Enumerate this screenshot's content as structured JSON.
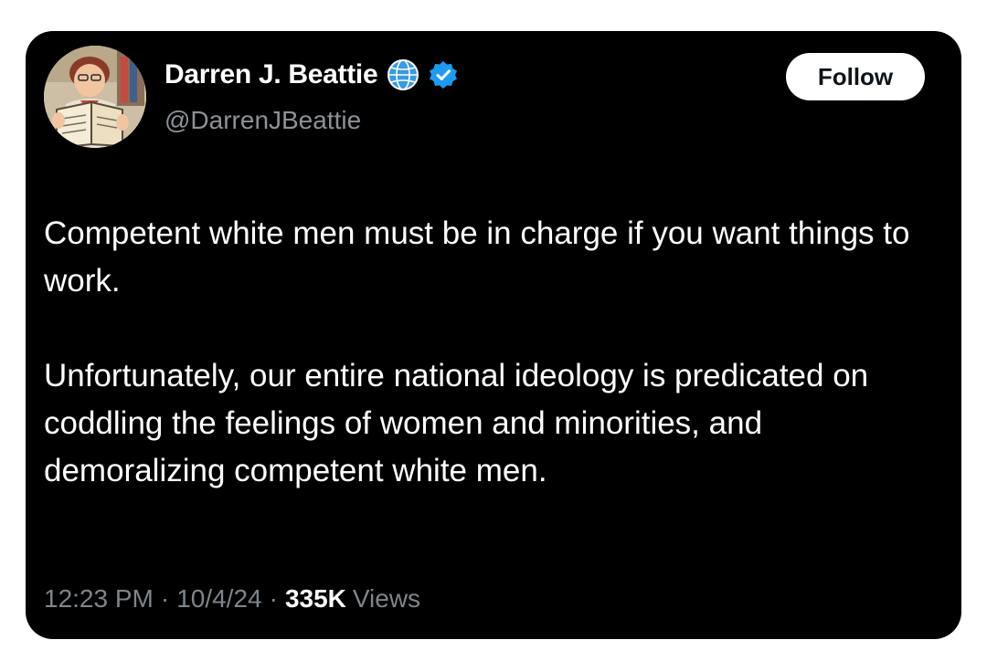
{
  "author": {
    "display_name": "Darren J. Beattie",
    "handle": "@DarrenJBeattie",
    "avatar_icon": "cartoon-man-reading-book-avatar",
    "badges": [
      "globe-badge-icon",
      "verified-badge-icon"
    ]
  },
  "follow_button": {
    "label": "Follow"
  },
  "tweet": {
    "paragraphs": [
      "Competent white men must be in charge if you want things to work.",
      "Unfortunately, our entire national ideology is predicated on coddling the feelings of women and minorities, and demoralizing competent white men."
    ]
  },
  "meta": {
    "time": "12:23 PM",
    "separator": "·",
    "date": "10/4/24",
    "views_count": "335K",
    "views_label": "Views"
  },
  "colors": {
    "card_background": "#000000",
    "verified_blue": "#1d9bf0",
    "secondary_text": "#8b9298"
  }
}
